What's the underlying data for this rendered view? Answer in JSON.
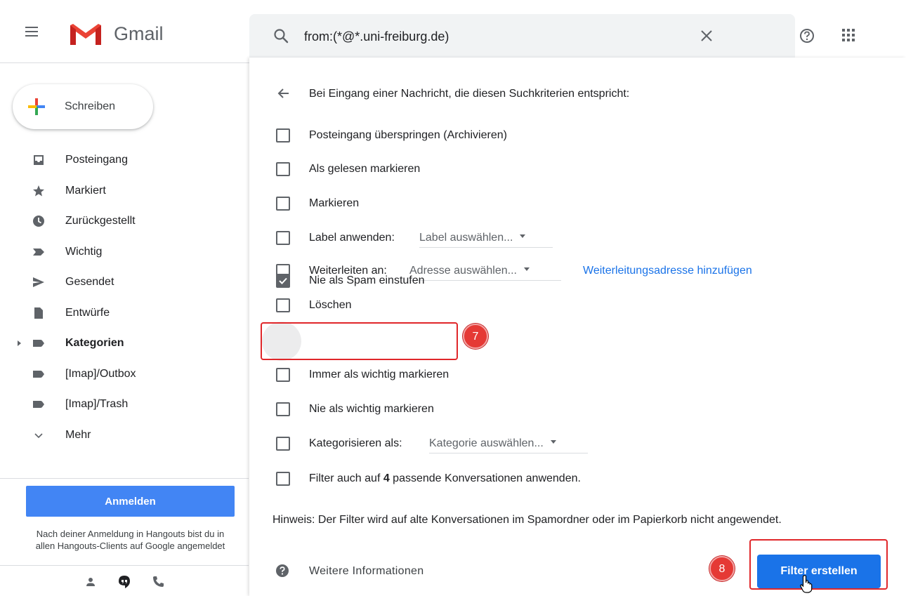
{
  "app": {
    "name": "Gmail"
  },
  "search": {
    "value": "from:(*@*.uni-freiburg.de)"
  },
  "sidebar": {
    "compose_label": "Schreiben",
    "items": [
      {
        "label": "Posteingang",
        "icon": "inbox-icon"
      },
      {
        "label": "Markiert",
        "icon": "star-icon"
      },
      {
        "label": "Zurückgestellt",
        "icon": "clock-icon"
      },
      {
        "label": "Wichtig",
        "icon": "important-icon"
      },
      {
        "label": "Gesendet",
        "icon": "send-icon"
      },
      {
        "label": "Entwürfe",
        "icon": "draft-icon"
      },
      {
        "label": "Kategorien",
        "icon": "label-icon",
        "bold": true,
        "expandable": true
      },
      {
        "label": "[Imap]/Outbox",
        "icon": "label-icon"
      },
      {
        "label": "[Imap]/Trash",
        "icon": "label-icon"
      },
      {
        "label": "Mehr",
        "icon": "chevron-down-icon"
      }
    ],
    "signin_label": "Anmelden",
    "signin_note": "Nach deiner Anmeldung in Hangouts bist du in allen Hangouts-Clients auf Google angemeldet"
  },
  "filter": {
    "heading": "Bei Eingang einer Nachricht, die diesen Suchkriterien entspricht:",
    "options": {
      "skip_inbox": {
        "label": "Posteingang überspringen (Archivieren)",
        "checked": false
      },
      "mark_read": {
        "label": "Als gelesen markieren",
        "checked": false
      },
      "star": {
        "label": "Markieren",
        "checked": false
      },
      "apply_label": {
        "label": "Label anwenden:",
        "select": "Label auswählen...",
        "checked": false
      },
      "forward": {
        "label": "Weiterleiten an:",
        "select": "Adresse auswählen...",
        "link": "Weiterleitungsadresse hinzufügen",
        "checked": false
      },
      "delete": {
        "label": "Löschen",
        "checked": false
      },
      "never_spam": {
        "label": "Nie als Spam einstufen",
        "checked": true
      },
      "always_important": {
        "label": "Immer als wichtig markieren",
        "checked": false
      },
      "never_important": {
        "label": "Nie als wichtig markieren",
        "checked": false
      },
      "categorize": {
        "label": "Kategorisieren als:",
        "select": "Kategorie auswählen...",
        "checked": false
      },
      "apply_existing": {
        "label_pre": "Filter auch auf ",
        "count": "4",
        "label_post": " passende Konversationen anwenden.",
        "checked": false
      }
    },
    "hint": "Hinweis: Der Filter wird auf alte Konversationen im Spamordner oder im Papierkorb nicht angewendet.",
    "more_info": "Weitere Informationen",
    "create_label": "Filter erstellen"
  },
  "annotations": {
    "step7": "7",
    "step8": "8",
    "highlight_color": "#e0272a"
  },
  "colors": {
    "accent": "#1a73e8",
    "signin": "#4285f4",
    "badge": "#e53935"
  }
}
